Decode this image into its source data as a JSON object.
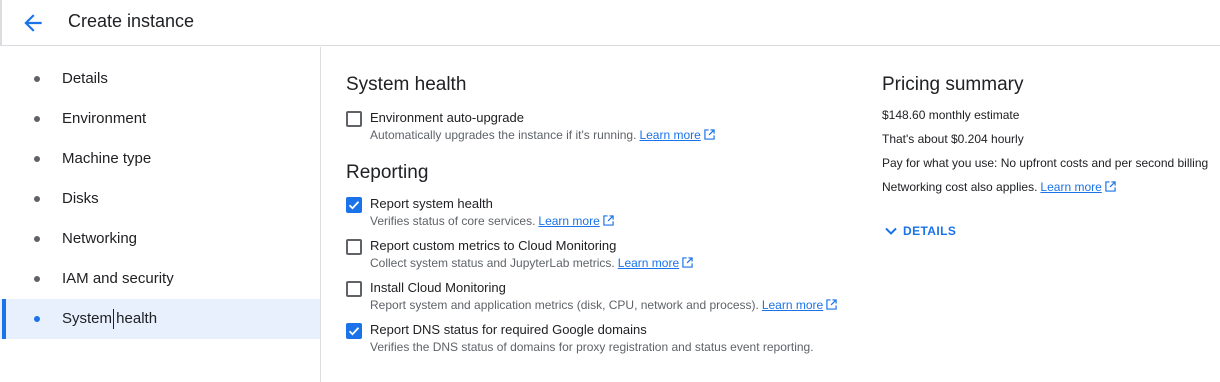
{
  "header": {
    "title": "Create instance"
  },
  "sidebar": {
    "items": [
      {
        "label": "Details"
      },
      {
        "label": "Environment"
      },
      {
        "label": "Machine type"
      },
      {
        "label": "Disks"
      },
      {
        "label": "Networking"
      },
      {
        "label": "IAM and security"
      },
      {
        "label": "System health",
        "active": true
      }
    ]
  },
  "system_health": {
    "title": "System health",
    "auto_upgrade": {
      "label": "Environment auto-upgrade",
      "checked": false,
      "description": "Automatically upgrades the instance if it's running.",
      "link": "Learn more"
    }
  },
  "reporting": {
    "title": "Reporting",
    "items": [
      {
        "label": "Report system health",
        "checked": true,
        "description": "Verifies status of core services.",
        "link": "Learn more"
      },
      {
        "label": "Report custom metrics to Cloud Monitoring",
        "checked": false,
        "description": "Collect system status and JupyterLab metrics.",
        "link": "Learn more"
      },
      {
        "label": "Install Cloud Monitoring",
        "checked": false,
        "description": "Report system and application metrics (disk, CPU, network and process).",
        "link": "Learn more"
      },
      {
        "label": "Report DNS status for required Google domains",
        "checked": true,
        "description": "Verifies the DNS status of domains for proxy registration and status event reporting."
      }
    ]
  },
  "pricing": {
    "title": "Pricing summary",
    "monthly": "$148.60 monthly estimate",
    "hourly": "That's about $0.204 hourly",
    "billing": "Pay for what you use: No upfront costs and per second billing",
    "networking": "Networking cost also applies.",
    "networking_link": "Learn more",
    "details_label": "DETAILS"
  },
  "colors": {
    "accent": "#1a73e8",
    "active_bg": "#e8f0fe",
    "text": "#202124",
    "muted": "#5f6368",
    "border": "#dadce0"
  },
  "icons": {
    "back": "arrow-left-icon",
    "external": "external-link-icon",
    "expand": "chevron-down-icon",
    "check": "check-icon"
  }
}
